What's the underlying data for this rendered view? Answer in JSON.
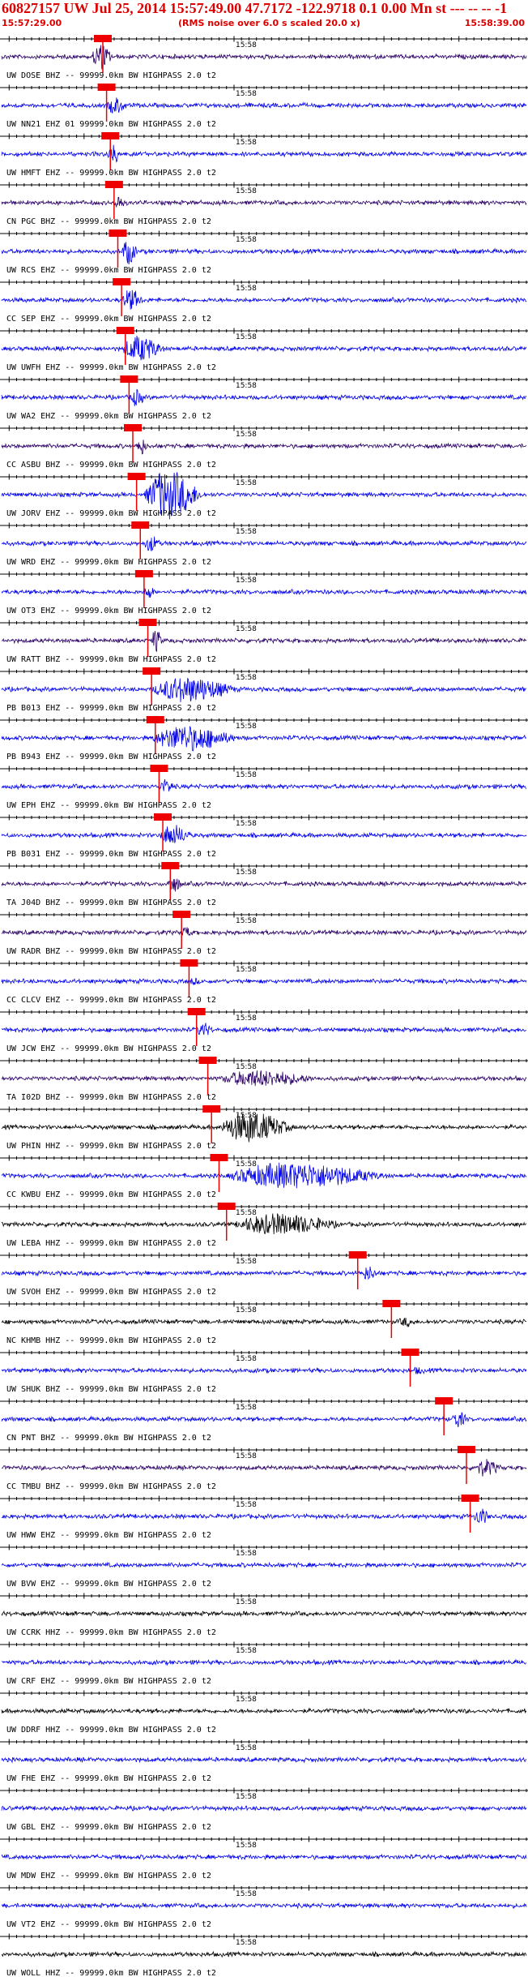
{
  "header": {
    "title": "60827157 UW Jul 25, 2014 15:57:49.00   47.7172 -122.9718  0.1 0.00 Mn st --- --  --  -1",
    "start_time": "15:57:29.00",
    "rms_note": "(RMS noise over 6.0 s scaled 20.0 x)",
    "end_time": "15:58:39.00"
  },
  "colors": {
    "header_text": "#dd0000",
    "blue": "#0000ee",
    "purple": "#2a0066",
    "black": "#000000",
    "pick": "#ee0000",
    "axis": "#000000"
  },
  "chart_data": {
    "type": "line",
    "xlabel": "",
    "ylabel": "",
    "x_range": [
      "15:57:29.00",
      "15:58:39.00"
    ],
    "tick_label": "15:58",
    "tick_label_time_s": 31,
    "traces": [
      {
        "label": "UW DOSE BHZ -- 99999.0km BW  HIGHPASS  2.0  t2",
        "color": "purple",
        "pick_s": 13.5,
        "event": [
          12,
          4,
          1.0
        ]
      },
      {
        "label": "UW NN21 EHZ 01 99999.0km BW  HIGHPASS  2.0  t2",
        "color": "blue",
        "pick_s": 14.0,
        "event": [
          14,
          4,
          0.6
        ]
      },
      {
        "label": "UW HMFT EHZ -- 99999.0km BW  HIGHPASS  2.0  t2",
        "color": "blue",
        "pick_s": 14.5,
        "event": [
          14,
          3,
          0.7
        ]
      },
      {
        "label": "CN PGC BHZ -- 99999.0km BW  HIGHPASS  2.0  t2",
        "color": "purple",
        "pick_s": 15.0,
        "event": [
          15,
          2,
          0.6
        ]
      },
      {
        "label": "UW RCS EHZ -- 99999.0km BW  HIGHPASS  2.0  t2",
        "color": "blue",
        "pick_s": 15.5,
        "event": [
          16,
          3,
          1.0
        ]
      },
      {
        "label": "CC SEP EHZ -- 99999.0km BW  HIGHPASS  2.0  t2",
        "color": "blue",
        "pick_s": 16.0,
        "event": [
          16,
          4,
          0.8
        ]
      },
      {
        "label": "UW UWFH EHZ -- 99999.0km BW  HIGHPASS  2.0  t2",
        "color": "blue",
        "pick_s": 16.5,
        "event": [
          16,
          8,
          1.0
        ]
      },
      {
        "label": "UW WA2 EHZ -- 99999.0km BW  HIGHPASS  2.0  t2",
        "color": "blue",
        "pick_s": 17.0,
        "event": [
          17,
          3,
          0.6
        ]
      },
      {
        "label": "CC ASBU BHZ -- 99999.0km BW  HIGHPASS  2.0  t2",
        "color": "purple",
        "pick_s": 17.5,
        "event": [
          18,
          2,
          0.7
        ]
      },
      {
        "label": "UW JORV EHZ -- 99999.0km BW  HIGHPASS  2.0  t2",
        "color": "blue",
        "pick_s": 18.0,
        "event": [
          19,
          11,
          2.0
        ]
      },
      {
        "label": "UW WRD EHZ -- 99999.0km BW  HIGHPASS  2.0  t2",
        "color": "blue",
        "pick_s": 18.5,
        "event": [
          19,
          3,
          0.6
        ]
      },
      {
        "label": "UW OT3 EHZ -- 99999.0km BW  HIGHPASS  2.0  t2",
        "color": "blue",
        "pick_s": 19.0,
        "event": [
          19,
          2,
          0.5
        ]
      },
      {
        "label": "UW RATT BHZ -- 99999.0km BW  HIGHPASS  2.0  t2",
        "color": "purple",
        "pick_s": 19.5,
        "event": [
          20,
          2,
          0.9
        ]
      },
      {
        "label": "PB B013 EHZ -- 99999.0km BW  HIGHPASS  2.0  t2",
        "color": "blue",
        "pick_s": 20.0,
        "event": [
          20,
          16,
          1.0
        ]
      },
      {
        "label": "PB B943 EHZ -- 99999.0km BW  HIGHPASS  2.0  t2",
        "color": "blue",
        "pick_s": 20.5,
        "event": [
          20,
          16,
          1.0
        ]
      },
      {
        "label": "UW EPH EHZ -- 99999.0km BW  HIGHPASS  2.0  t2",
        "color": "blue",
        "pick_s": 21.0,
        "event": [
          21,
          3,
          0.5
        ]
      },
      {
        "label": "PB B031 EHZ -- 99999.0km BW  HIGHPASS  2.0  t2",
        "color": "blue",
        "pick_s": 21.5,
        "event": [
          21,
          6,
          0.8
        ]
      },
      {
        "label": "TA J04D BHZ -- 99999.0km BW  HIGHPASS  2.0  t2",
        "color": "purple",
        "pick_s": 22.5,
        "event": [
          22,
          3,
          0.6
        ]
      },
      {
        "label": "UW RADR BHZ -- 99999.0km BW  HIGHPASS  2.0  t2",
        "color": "purple",
        "pick_s": 24.0,
        "event": [
          24,
          2,
          0.4
        ]
      },
      {
        "label": "CC CLCV EHZ -- 99999.0km BW  HIGHPASS  2.0  t2",
        "color": "blue",
        "pick_s": 25.0,
        "event": [
          25,
          2,
          0.2
        ]
      },
      {
        "label": "UW JCW EHZ -- 99999.0km BW  HIGHPASS  2.0  t2",
        "color": "blue",
        "pick_s": 26.0,
        "event": [
          26,
          3,
          0.5
        ]
      },
      {
        "label": "TA I02D BHZ -- 99999.0km BW  HIGHPASS  2.0  t2",
        "color": "purple",
        "pick_s": 27.5,
        "event": [
          29,
          18,
          0.6
        ]
      },
      {
        "label": "UW PHIN HHZ -- 99999.0km BW  HIGHPASS  2.0  t2",
        "color": "black",
        "pick_s": 28.0,
        "event": [
          29,
          14,
          1.2
        ]
      },
      {
        "label": "CC KWBU EHZ -- 99999.0km BW  HIGHPASS  2.0  t2",
        "color": "blue",
        "pick_s": 29.0,
        "event": [
          30,
          30,
          1.0
        ]
      },
      {
        "label": "UW LEBA HHZ -- 99999.0km BW  HIGHPASS  2.0  t2",
        "color": "black",
        "pick_s": 30.0,
        "event": [
          31,
          20,
          0.8
        ]
      },
      {
        "label": "UW SVOH EHZ -- 99999.0km BW  HIGHPASS  2.0  t2",
        "color": "blue",
        "pick_s": 47.5,
        "event": [
          48,
          3,
          0.5
        ]
      },
      {
        "label": "NC KHMB HHZ -- 99999.0km BW  HIGHPASS  2.0  t2",
        "color": "black",
        "pick_s": 52.0,
        "event": [
          53,
          3,
          0.3
        ]
      },
      {
        "label": "UW SHUK BHZ -- 99999.0km BW  HIGHPASS  2.0  t2",
        "color": "blue",
        "pick_s": 54.5,
        "event": [
          55,
          2,
          0.2
        ]
      },
      {
        "label": "CN PNT BHZ -- 99999.0km BW  HIGHPASS  2.0  t2",
        "color": "blue",
        "pick_s": 59.0,
        "event": [
          60,
          3,
          0.6
        ]
      },
      {
        "label": "CC TMBU BHZ -- 99999.0km BW  HIGHPASS  2.0  t2",
        "color": "purple",
        "pick_s": 62.0,
        "event": [
          63,
          5,
          0.6
        ]
      },
      {
        "label": "UW HWW EHZ -- 99999.0km BW  HIGHPASS  2.0  t2",
        "color": "blue",
        "pick_s": 62.5,
        "event": [
          63,
          3,
          0.6
        ]
      },
      {
        "label": "UW BVW EHZ -- 99999.0km BW  HIGHPASS  2.0  t2",
        "color": "blue",
        "pick_s": null,
        "event": null
      },
      {
        "label": "UW CCRK HHZ -- 99999.0km BW  HIGHPASS  2.0  t2",
        "color": "black",
        "pick_s": null,
        "event": null
      },
      {
        "label": "UW CRF EHZ -- 99999.0km BW  HIGHPASS  2.0  t2",
        "color": "blue",
        "pick_s": null,
        "event": null
      },
      {
        "label": "UW DDRF HHZ -- 99999.0km BW  HIGHPASS  2.0  t2",
        "color": "black",
        "pick_s": null,
        "event": null
      },
      {
        "label": "UW FHE EHZ -- 99999.0km BW  HIGHPASS  2.0  t2",
        "color": "blue",
        "pick_s": null,
        "event": null
      },
      {
        "label": "UW GBL EHZ -- 99999.0km BW  HIGHPASS  2.0  t2",
        "color": "blue",
        "pick_s": null,
        "event": null
      },
      {
        "label": "UW MDW EHZ -- 99999.0km BW  HIGHPASS  2.0  t2",
        "color": "blue",
        "pick_s": null,
        "event": null
      },
      {
        "label": "UW VT2 EHZ -- 99999.0km BW  HIGHPASS  2.0  t2",
        "color": "blue",
        "pick_s": null,
        "event": null
      },
      {
        "label": "UW WOLL HHZ -- 99999.0km BW  HIGHPASS  2.0  t2",
        "color": "black",
        "pick_s": null,
        "event": null
      }
    ]
  }
}
